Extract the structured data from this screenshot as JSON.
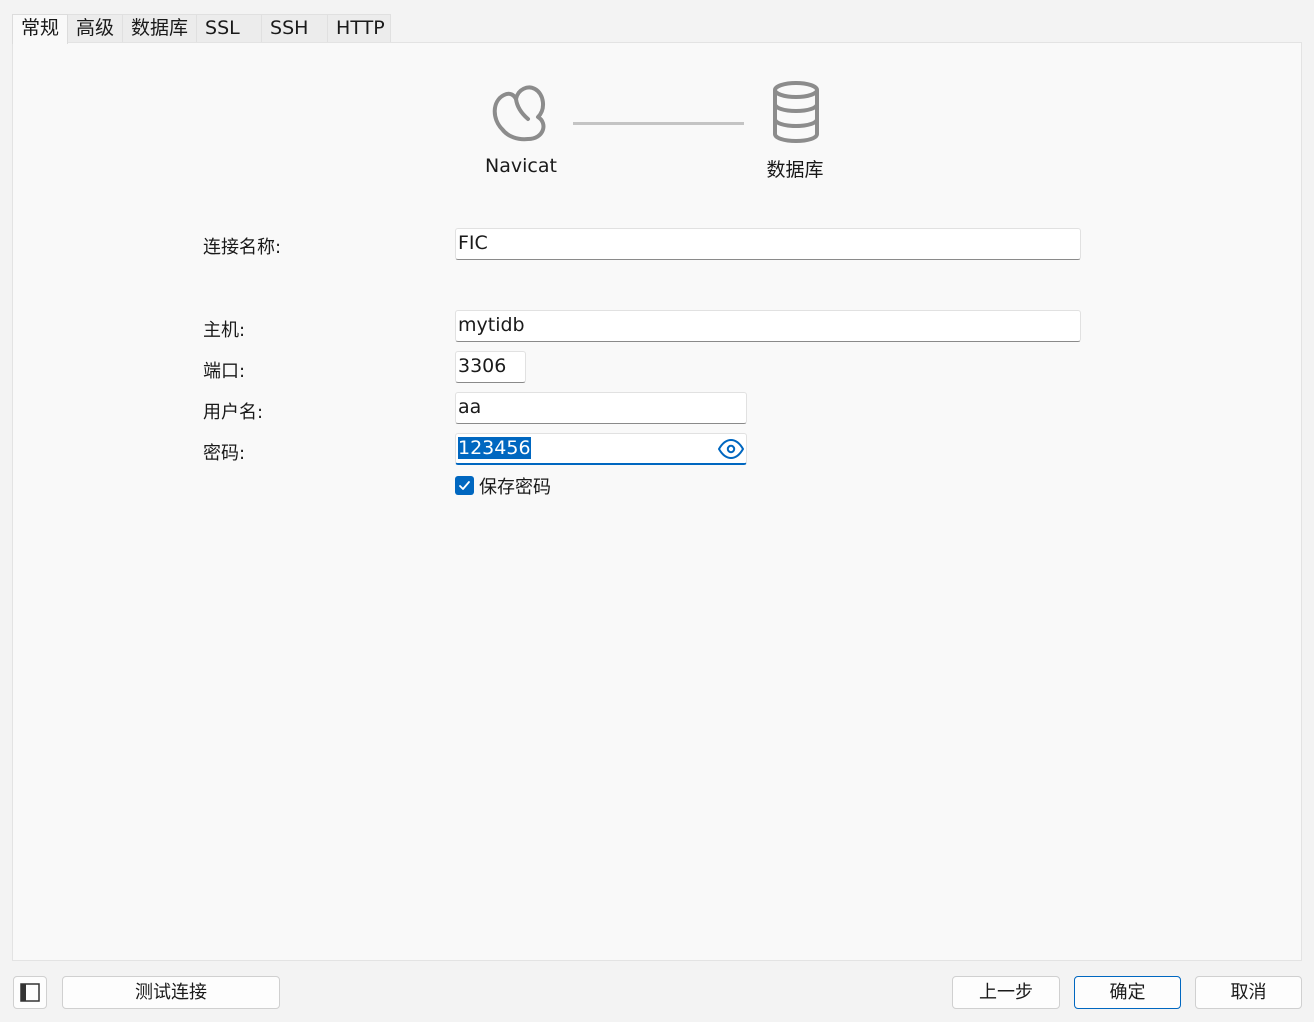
{
  "tabs": [
    {
      "label": "常规",
      "active": true
    },
    {
      "label": "高级"
    },
    {
      "label": "数据库"
    },
    {
      "label": "SSL"
    },
    {
      "label": "SSH"
    },
    {
      "label": "HTTP"
    }
  ],
  "diagram": {
    "source_label": "Navicat",
    "target_label": "数据库",
    "source_icon": "navicat-logo-icon",
    "target_icon": "database-icon"
  },
  "form": {
    "connection_name_label": "连接名称:",
    "connection_name_value": "FIC",
    "host_label": "主机:",
    "host_value": "mytidb",
    "port_label": "端口:",
    "port_value": "3306",
    "username_label": "用户名:",
    "username_value": "aa",
    "password_label": "密码:",
    "password_value": "123456",
    "save_password_label": "保存密码",
    "save_password_checked": true
  },
  "buttons": {
    "test_connection": "测试连接",
    "previous": "上一步",
    "ok": "确定",
    "cancel": "取消"
  },
  "colors": {
    "accent": "#0067c0",
    "panel_bg": "#f9f9f9",
    "icon_gray": "#8c8c8c"
  }
}
